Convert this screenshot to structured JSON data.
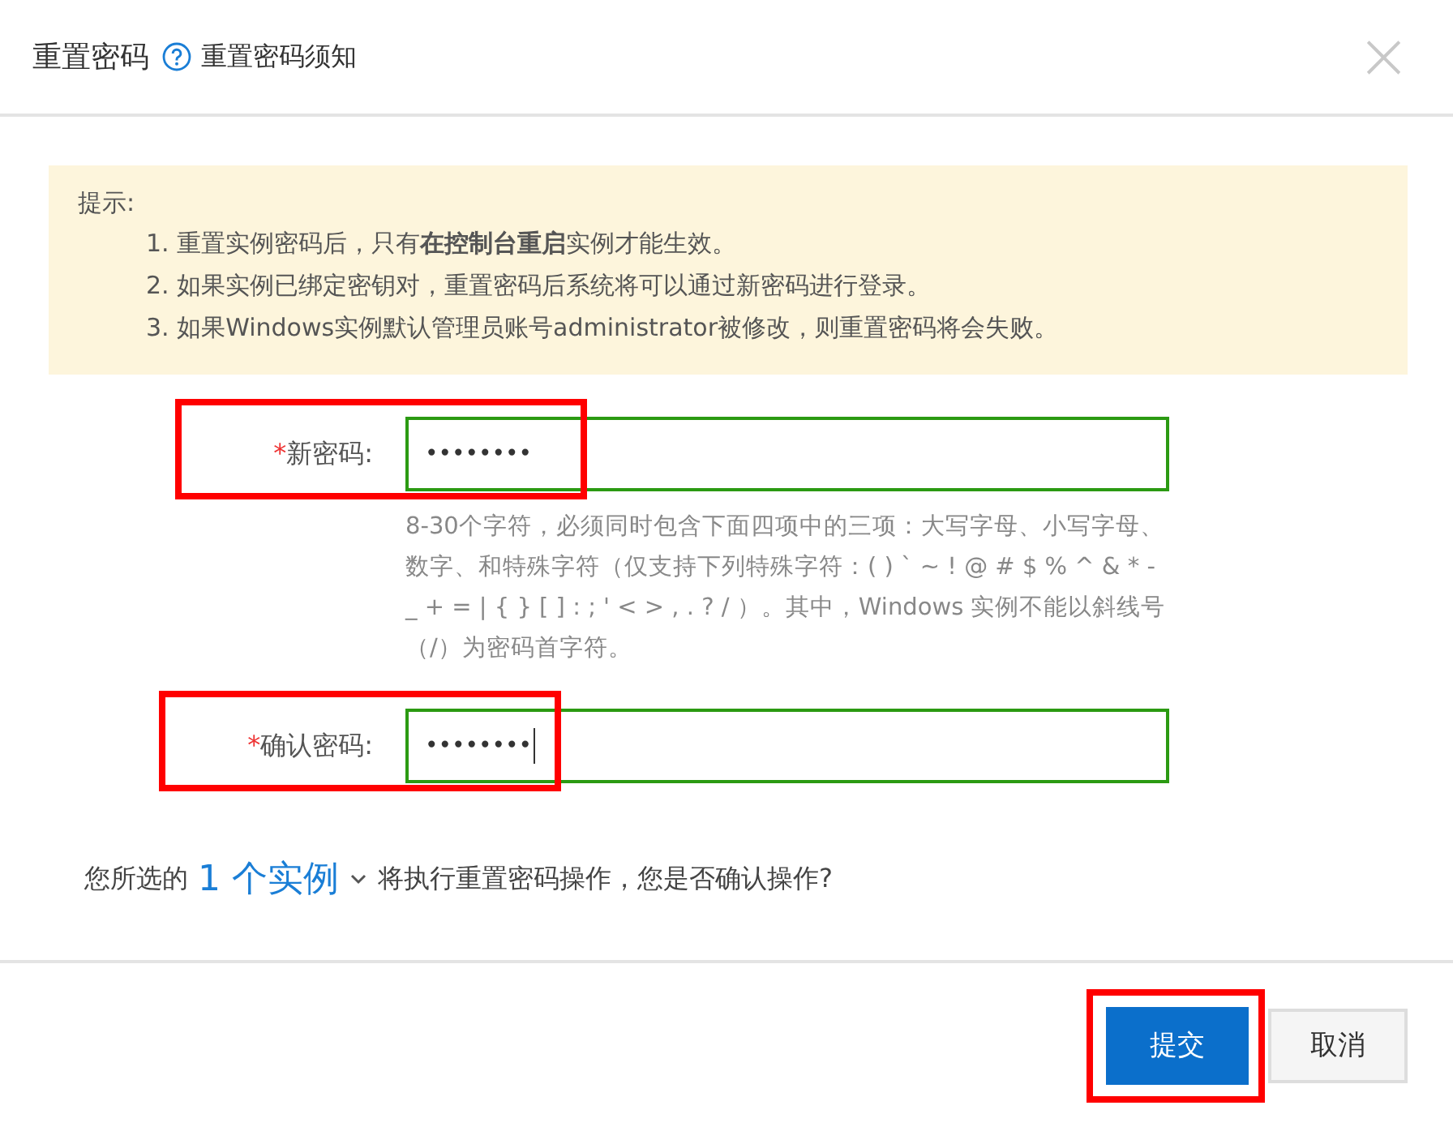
{
  "dialog": {
    "title": "重置密码",
    "help_link": "重置密码须知",
    "close": "×"
  },
  "notice": {
    "heading": "提示:",
    "items": [
      {
        "number": "1.",
        "text": "重置实例密码后，只有**在控制台重启**实例才能生效。"
      },
      {
        "number": "2.",
        "text": "如果实例已绑定密钥对，重置密码后系统将可以通过新密码进行登录。"
      },
      {
        "number": "3.",
        "text": "如果Windows实例默认管理员账号administrator被修改，则重置密码将会失败。"
      }
    ]
  },
  "fields": [
    {
      "required_mark": "*",
      "label": "新密码:",
      "value": "••••••••",
      "focused": false,
      "highlighted": true,
      "hint": "8-30个字符，必须同时包含下面四项中的三项：大写字母、小写字母、数字、和特殊字符（仅支持下列特殊字符：( ) ` ~ ! @ # $ % ^ & * - _ + = | { } [ ] : ; ' < > , . ? / ）。其中，Windows 实例不能以斜线号（/）为密码首字符。"
    },
    {
      "required_mark": "*",
      "label": "确认密码:",
      "value": "••••••••",
      "focused": true,
      "highlighted": true
    }
  ],
  "summary": {
    "before": "您所选的",
    "link": "1 个实例",
    "after": "将执行重置密码操作，您是否确认操作?"
  },
  "buttons": [
    {
      "label": "提交",
      "kind": "primary",
      "highlighted": true
    },
    {
      "label": "取消",
      "kind": "secondary",
      "highlighted": false
    }
  ]
}
